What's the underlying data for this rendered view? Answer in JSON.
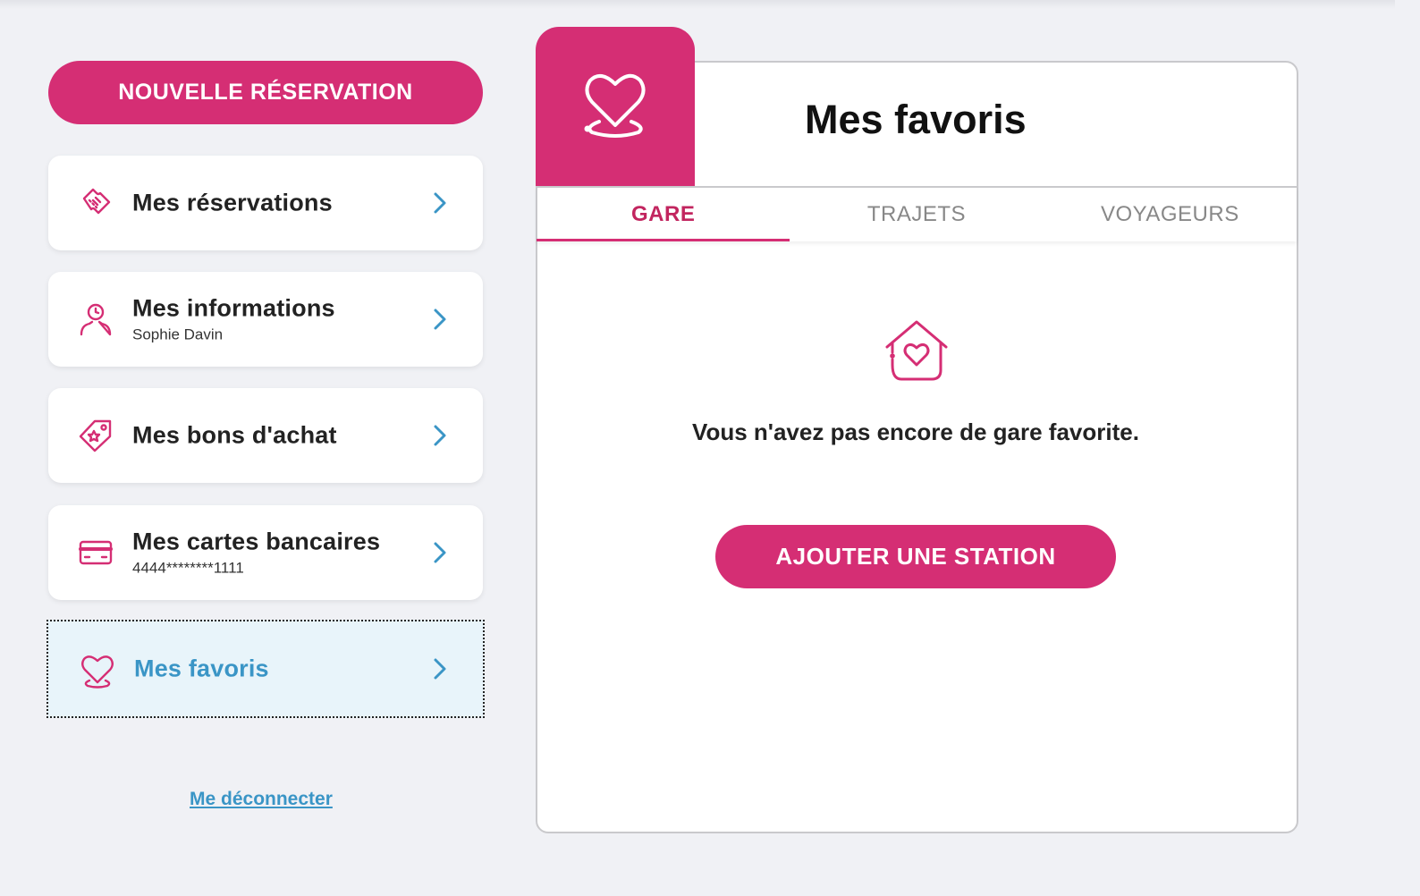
{
  "colors": {
    "accent": "#d52e74",
    "link": "#3a95c6",
    "background": "#f0f1f5"
  },
  "sidebar": {
    "new_booking_label": "NOUVELLE RÉSERVATION",
    "items": [
      {
        "label": "Mes réservations",
        "sub": "",
        "icon": "ticket-icon"
      },
      {
        "label": "Mes informations",
        "sub": "Sophie Davin",
        "icon": "user-icon"
      },
      {
        "label": "Mes bons d'achat",
        "sub": "",
        "icon": "voucher-tag-icon"
      },
      {
        "label": "Mes cartes bancaires",
        "sub": "4444********1111",
        "icon": "credit-card-icon"
      },
      {
        "label": "Mes favoris",
        "sub": "",
        "icon": "heart-icon",
        "active": true
      }
    ],
    "logout_label": "Me déconnecter"
  },
  "main": {
    "title": "Mes favoris",
    "header_icon": "heart-icon",
    "tabs": [
      {
        "label": "GARE",
        "active": true
      },
      {
        "label": "TRAJETS"
      },
      {
        "label": "VOYAGEURS"
      }
    ],
    "empty_icon": "house-heart-icon",
    "empty_message": "Vous n'avez pas encore de gare favorite.",
    "add_button_label": "AJOUTER UNE STATION"
  }
}
